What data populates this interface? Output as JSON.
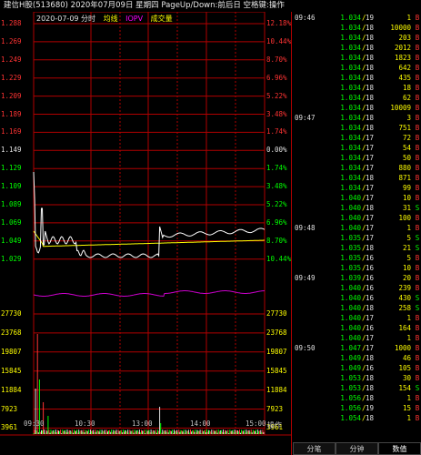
{
  "title": "建信H股(513680)  2020年07月09日 星期四 PageUp/Down:前后日 空格键:操作",
  "legend": {
    "date": "2020-07-09 分时",
    "avg_label": "均线",
    "iopv_label": "IOPV",
    "vol_label": "成交量",
    "avg_color": "#ffff00",
    "iopv_color": "#ff00ff",
    "vol_color": "#ffff00"
  },
  "colors": {
    "up": "#ff3333",
    "down": "#00ff00",
    "flat": "#e0e0e0",
    "grid": "#b00000",
    "price_line": "#ffffff",
    "avg_line": "#ffff00",
    "iopv_line": "#cc00cc"
  },
  "price_axis": [
    {
      "left": "1.288",
      "right": "12.18%",
      "color": "up"
    },
    {
      "left": "1.269",
      "right": "10.44%",
      "color": "up"
    },
    {
      "left": "1.249",
      "right": "8.70%",
      "color": "up"
    },
    {
      "left": "1.229",
      "right": "6.96%",
      "color": "up"
    },
    {
      "left": "1.209",
      "right": "5.22%",
      "color": "up"
    },
    {
      "left": "1.189",
      "right": "3.48%",
      "color": "up"
    },
    {
      "left": "1.169",
      "right": "1.74%",
      "color": "up"
    },
    {
      "left": "1.149",
      "right": "0.00%",
      "color": "flat"
    },
    {
      "left": "1.129",
      "right": "1.74%",
      "color": "down"
    },
    {
      "left": "1.109",
      "right": "3.48%",
      "color": "down"
    },
    {
      "left": "1.089",
      "right": "5.22%",
      "color": "down"
    },
    {
      "left": "1.069",
      "right": "6.96%",
      "color": "down"
    },
    {
      "left": "1.049",
      "right": "8.70%",
      "color": "down"
    },
    {
      "left": "1.029",
      "right": "10.44%",
      "color": "down"
    }
  ],
  "volume_axis": [
    "27730",
    "23768",
    "19807",
    "15845",
    "11884",
    "7923",
    "3961"
  ],
  "volume_axis_color": "#ffff00",
  "time_axis": [
    "09:30",
    "10:30",
    "13:00",
    "14:00",
    "15:00"
  ],
  "op_label": "操作",
  "ticks": [
    {
      "time": "09:46",
      "price": "1.034",
      "sec": "19",
      "vol": "1",
      "bs": "B"
    },
    {
      "time": "",
      "price": "1.034",
      "sec": "18",
      "vol": "10000",
      "bs": "B"
    },
    {
      "time": "",
      "price": "1.034",
      "sec": "18",
      "vol": "203",
      "bs": "B"
    },
    {
      "time": "",
      "price": "1.034",
      "sec": "18",
      "vol": "2012",
      "bs": "B"
    },
    {
      "time": "",
      "price": "1.034",
      "sec": "18",
      "vol": "1823",
      "bs": "B"
    },
    {
      "time": "",
      "price": "1.034",
      "sec": "18",
      "vol": "642",
      "bs": "B"
    },
    {
      "time": "",
      "price": "1.034",
      "sec": "18",
      "vol": "435",
      "bs": "B"
    },
    {
      "time": "",
      "price": "1.034",
      "sec": "18",
      "vol": "18",
      "bs": "B"
    },
    {
      "time": "",
      "price": "1.034",
      "sec": "18",
      "vol": "62",
      "bs": "B"
    },
    {
      "time": "",
      "price": "1.034",
      "sec": "18",
      "vol": "10009",
      "bs": "B"
    },
    {
      "time": "09:47",
      "price": "1.034",
      "sec": "18",
      "vol": "3",
      "bs": "B"
    },
    {
      "time": "",
      "price": "1.034",
      "sec": "18",
      "vol": "751",
      "bs": "B"
    },
    {
      "time": "",
      "price": "1.034",
      "sec": "17",
      "vol": "72",
      "bs": "B"
    },
    {
      "time": "",
      "price": "1.034",
      "sec": "17",
      "vol": "54",
      "bs": "B"
    },
    {
      "time": "",
      "price": "1.034",
      "sec": "17",
      "vol": "50",
      "bs": "B"
    },
    {
      "time": "",
      "price": "1.034",
      "sec": "17",
      "vol": "880",
      "bs": "B"
    },
    {
      "time": "",
      "price": "1.034",
      "sec": "18",
      "vol": "871",
      "bs": "B"
    },
    {
      "time": "",
      "price": "1.034",
      "sec": "17",
      "vol": "99",
      "bs": "B"
    },
    {
      "time": "",
      "price": "1.040",
      "sec": "17",
      "vol": "10",
      "bs": "B"
    },
    {
      "time": "",
      "price": "1.040",
      "sec": "18",
      "vol": "31",
      "bs": "S"
    },
    {
      "time": "",
      "price": "1.040",
      "sec": "17",
      "vol": "100",
      "bs": "B"
    },
    {
      "time": "09:48",
      "price": "1.040",
      "sec": "17",
      "vol": "1",
      "bs": "B"
    },
    {
      "time": "",
      "price": "1.035",
      "sec": "17",
      "vol": "5",
      "bs": "S"
    },
    {
      "time": "",
      "price": "1.035",
      "sec": "18",
      "vol": "21",
      "bs": "S"
    },
    {
      "time": "",
      "price": "1.035",
      "sec": "16",
      "vol": "5",
      "bs": "B"
    },
    {
      "time": "",
      "price": "1.035",
      "sec": "16",
      "vol": "10",
      "bs": "B"
    },
    {
      "time": "09:49",
      "price": "1.039",
      "sec": "16",
      "vol": "20",
      "bs": "B"
    },
    {
      "time": "",
      "price": "1.040",
      "sec": "16",
      "vol": "239",
      "bs": "B"
    },
    {
      "time": "",
      "price": "1.040",
      "sec": "16",
      "vol": "430",
      "bs": "S"
    },
    {
      "time": "",
      "price": "1.040",
      "sec": "18",
      "vol": "258",
      "bs": "S"
    },
    {
      "time": "",
      "price": "1.040",
      "sec": "17",
      "vol": "1",
      "bs": "B"
    },
    {
      "time": "",
      "price": "1.040",
      "sec": "16",
      "vol": "164",
      "bs": "B"
    },
    {
      "time": "",
      "price": "1.040",
      "sec": "17",
      "vol": "1",
      "bs": "B"
    },
    {
      "time": "09:50",
      "price": "1.047",
      "sec": "17",
      "vol": "1000",
      "bs": "B"
    },
    {
      "time": "",
      "price": "1.049",
      "sec": "18",
      "vol": "46",
      "bs": "B"
    },
    {
      "time": "",
      "price": "1.049",
      "sec": "16",
      "vol": "105",
      "bs": "B"
    },
    {
      "time": "",
      "price": "1.053",
      "sec": "18",
      "vol": "30",
      "bs": "B"
    },
    {
      "time": "",
      "price": "1.053",
      "sec": "18",
      "vol": "154",
      "bs": "S"
    },
    {
      "time": "",
      "price": "1.056",
      "sec": "18",
      "vol": "1",
      "bs": "B"
    },
    {
      "time": "",
      "price": "1.056",
      "sec": "19",
      "vol": "15",
      "bs": "B"
    },
    {
      "time": "",
      "price": "1.054",
      "sec": "18",
      "vol": "1",
      "bs": "B"
    }
  ],
  "tabs": [
    "分笔",
    "分钟",
    "数值"
  ],
  "active_tab": 2
}
